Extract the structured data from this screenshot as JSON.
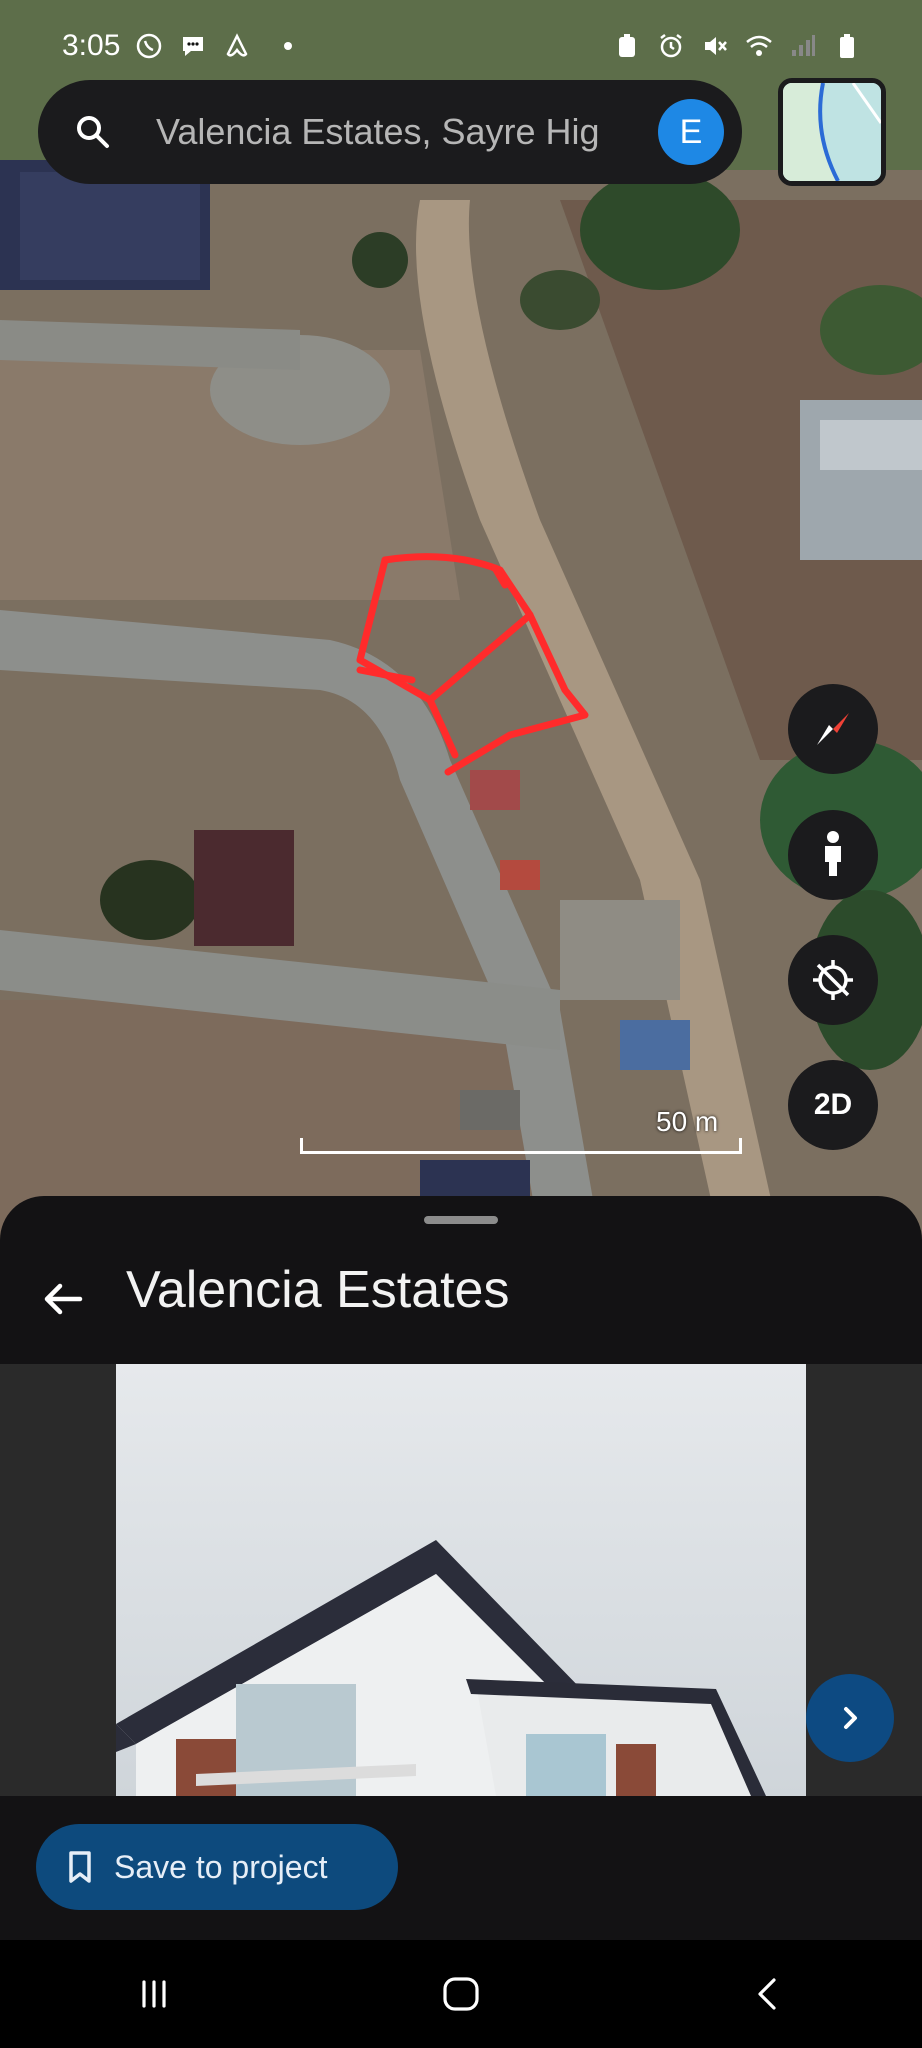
{
  "status_bar": {
    "time": "3:05",
    "left_icons": [
      "viber-icon",
      "messages-icon",
      "airbnb-icon"
    ],
    "right_icons": [
      "battery-saver-icon",
      "alarm-icon",
      "mute-icon",
      "wifi-icon",
      "signal-icon",
      "battery-icon"
    ]
  },
  "search": {
    "text": "Valencia Estates, Sayre Hig",
    "avatar_letter": "E"
  },
  "map": {
    "scale_label": "50 m",
    "controls": {
      "compass": "compass-icon",
      "street_view": "pegman-icon",
      "location": "location-off-icon",
      "view_mode": "2D"
    },
    "annotation_color": "#ff2b2b"
  },
  "sheet": {
    "title": "Valencia Estates",
    "save_label": "Save to project"
  },
  "colors": {
    "accent": "#1e88e5",
    "save_button": "#0d4a7d"
  },
  "nav": {
    "items": [
      "recents-icon",
      "home-icon",
      "back-icon"
    ]
  }
}
